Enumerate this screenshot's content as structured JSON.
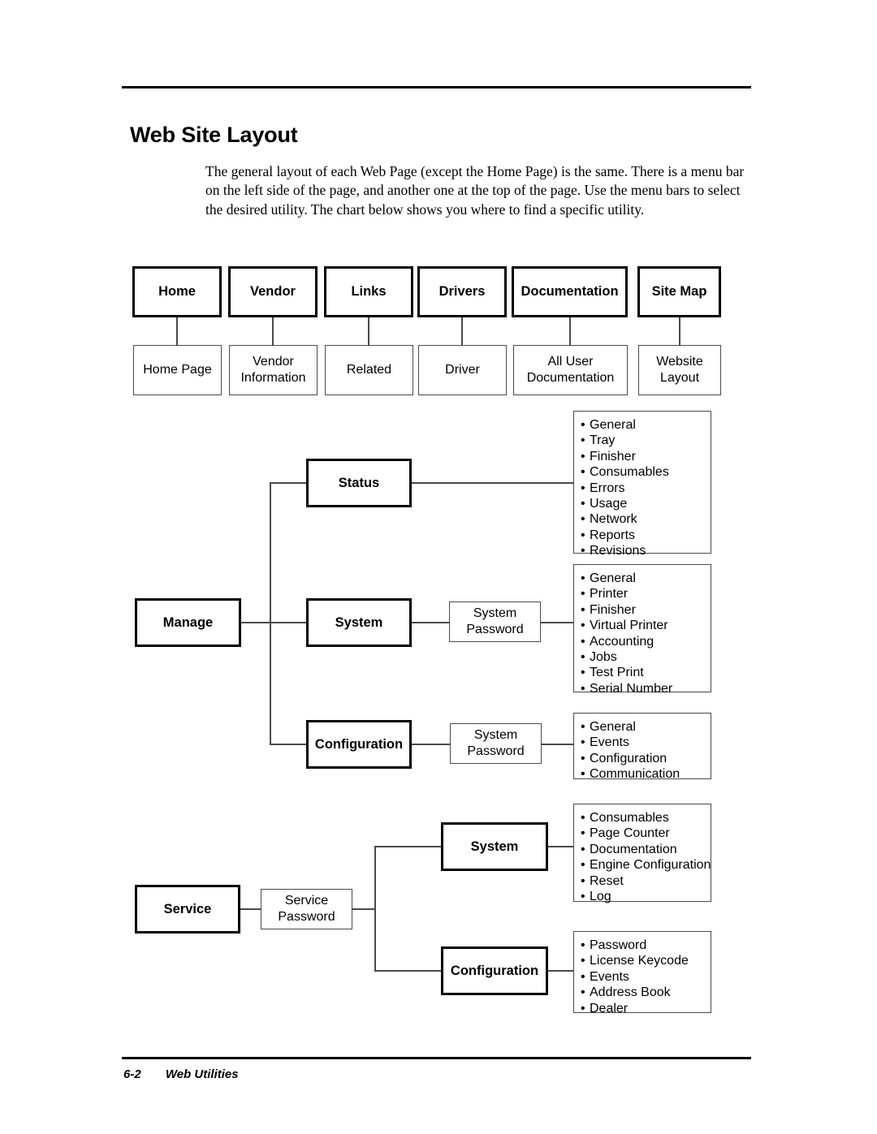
{
  "page": {
    "title": "Web Site Layout",
    "intro": "The general layout of each Web Page (except the Home Page) is the same. There is a menu bar on the left side of the page, and another one at the top of the page. Use the menu bars to select the desired utility. The chart below shows you where to find a specific utility.",
    "footer_page_number": "6-2",
    "footer_section": "Web Utilities"
  },
  "top_menu": [
    {
      "label": "Home",
      "child": "Home Page"
    },
    {
      "label": "Vendor",
      "child": "Vendor\nInformation"
    },
    {
      "label": "Links",
      "child": "Related"
    },
    {
      "label": "Drivers",
      "child": "Driver"
    },
    {
      "label": "Documentation",
      "child": "All User\nDocumentation"
    },
    {
      "label": "Site Map",
      "child": "Website\nLayout"
    }
  ],
  "manage": {
    "label": "Manage",
    "branches": [
      {
        "label": "Status",
        "password": null,
        "items": [
          "General",
          "Tray",
          "Finisher",
          "Consumables",
          "Errors",
          "Usage",
          "Network",
          "Reports",
          "Revisions"
        ]
      },
      {
        "label": "System",
        "password": "System\nPassword",
        "items": [
          "General",
          "Printer",
          "Finisher",
          "Virtual Printer",
          "Accounting",
          "Jobs",
          "Test Print",
          "Serial Number"
        ]
      },
      {
        "label": "Configuration",
        "password": "System\nPassword",
        "items": [
          "General",
          "Events",
          "Configuration",
          "Communication"
        ]
      }
    ]
  },
  "service": {
    "label": "Service",
    "password": "Service\nPassword",
    "branches": [
      {
        "label": "System",
        "items": [
          "Consumables",
          "Page Counter",
          "Documentation",
          "Engine Configuration",
          "Reset",
          "Log"
        ]
      },
      {
        "label": "Configuration",
        "items": [
          "Password",
          "License Keycode",
          "Events",
          "Address Book",
          "Dealer"
        ]
      }
    ]
  }
}
